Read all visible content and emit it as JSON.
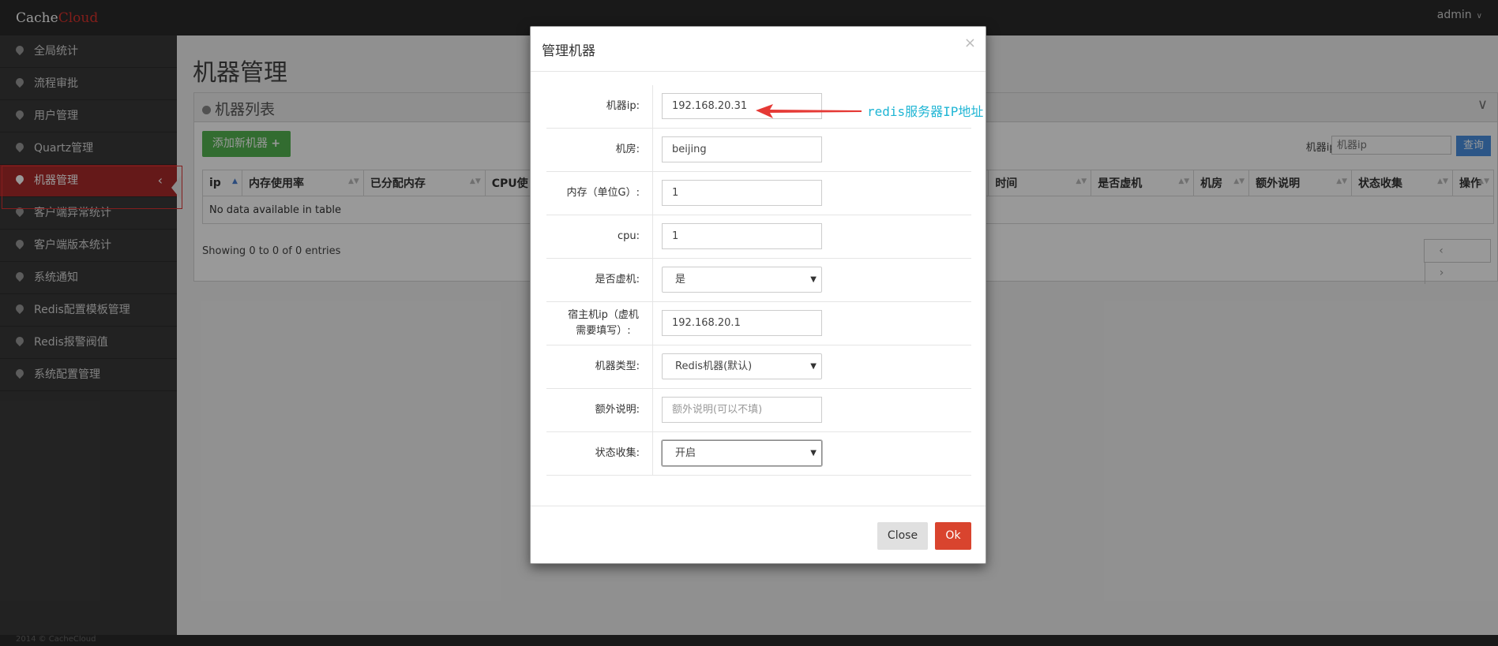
{
  "app": {
    "brand_part1": "Cache",
    "brand_part2": "Cloud",
    "brand_accent_color": "#d9322c",
    "user": "admin"
  },
  "sidebar": {
    "items": [
      {
        "label": "全局统计"
      },
      {
        "label": "流程审批"
      },
      {
        "label": "用户管理"
      },
      {
        "label": "Quartz管理"
      },
      {
        "label": "机器管理",
        "active": true
      },
      {
        "label": "客户端异常统计"
      },
      {
        "label": "客户端版本统计"
      },
      {
        "label": "系统通知"
      },
      {
        "label": "Redis配置模板管理"
      },
      {
        "label": "Redis报警阀值"
      },
      {
        "label": "系统配置管理"
      }
    ]
  },
  "main": {
    "page_title": "机器管理",
    "box_title": "机器列表",
    "add_button": "添加新机器",
    "search_label": "机器ip:",
    "search_placeholder": "机器ip",
    "search_button": "查询",
    "columns": [
      "ip",
      "内存使用率",
      "已分配内存",
      "CPU使",
      "时间",
      "是否虚机",
      "机房",
      "额外说明",
      "状态收集",
      "操作"
    ],
    "empty_text": "No data available in table",
    "showing": "Showing 0 to 0 of 0 entries",
    "pager_prev": "‹",
    "pager_next": "›"
  },
  "modal": {
    "title": "管理机器",
    "close_x": "×",
    "fields": [
      {
        "label": "机器ip:",
        "value": "192.168.20.31"
      },
      {
        "label": "机房:",
        "value": "beijing"
      },
      {
        "label": "内存（单位G）:",
        "value": "1"
      },
      {
        "label": "cpu:",
        "value": "1"
      },
      {
        "label": "是否虚机:",
        "value": "是"
      },
      {
        "label": "宿主机ip（虚机需要填写）:",
        "value": "192.168.20.1"
      },
      {
        "label": "机器类型:",
        "value": "Redis机器(默认)"
      },
      {
        "label": "额外说明:",
        "placeholder": "额外说明(可以不填)"
      },
      {
        "label": "状态收集:",
        "value": "开启"
      }
    ],
    "close_button": "Close",
    "ok_button": "Ok"
  },
  "annotation": {
    "text": "redis服务器IP地址",
    "color": "#1fb5d4",
    "arrow_color": "#e53935"
  },
  "footer": {
    "text": "2014 © CacheCloud"
  }
}
